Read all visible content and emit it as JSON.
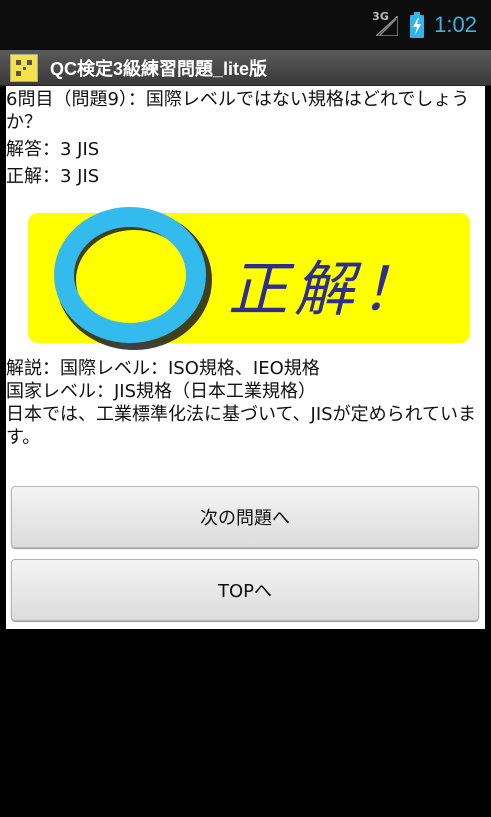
{
  "status_bar": {
    "network_label": "3G",
    "time": "1:02"
  },
  "title_bar": {
    "title": "QC検定3級練習問題_lite版"
  },
  "question": {
    "text": "6問目（問題9）：国際レベルではない規格はどれでしょうか？",
    "answer": "解答：3 JIS",
    "correct": "正解：3 JIS"
  },
  "banner": {
    "text": "正解！"
  },
  "explanation": {
    "line1": "解説：国際レベル：ISO規格、IEO規格",
    "line2": "国家レベル：JIS規格（日本工業規格）",
    "line3": "日本では、工業標準化法に基づいて、JISが定められています。"
  },
  "buttons": {
    "next": "次の問題へ",
    "top": "TOPへ"
  },
  "colors": {
    "clock": "#33b5e5",
    "banner_bg": "#ffff00",
    "circle": "#33bbee",
    "banner_text": "#2e2e8f"
  }
}
